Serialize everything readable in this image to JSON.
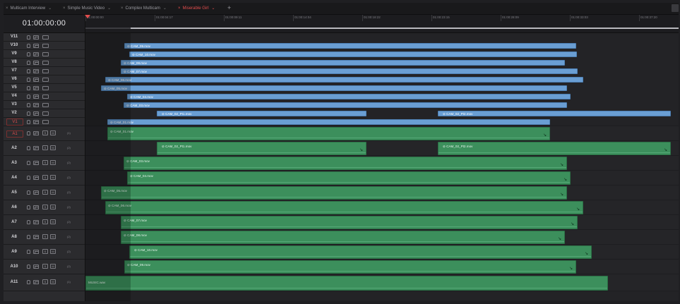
{
  "tabs": [
    {
      "label": "Multicam Interview",
      "active": false
    },
    {
      "label": "Simple Music Video",
      "active": false
    },
    {
      "label": "Complex Multicam",
      "active": false
    },
    {
      "label": "Miserable Girl",
      "active": true
    }
  ],
  "add_tab_label": "+",
  "timecode": "01:00:00:00",
  "ruler_ticks": [
    "01:00:00:00",
    "01:00:04:17",
    "01:00:09:11",
    "01:00:14:04",
    "01:00:18:22",
    "01:00:23:15",
    "01:00:28:09",
    "01:00:33:03",
    "01:00:37:20"
  ],
  "video_tracks": [
    {
      "name": "V11"
    },
    {
      "name": "V10"
    },
    {
      "name": "V9"
    },
    {
      "name": "V8"
    },
    {
      "name": "V7"
    },
    {
      "name": "V6"
    },
    {
      "name": "V5"
    },
    {
      "name": "V4"
    },
    {
      "name": "V3"
    },
    {
      "name": "V2"
    },
    {
      "name": "V1"
    }
  ],
  "audio_tracks": [
    {
      "name": "A1",
      "channels": "(1)",
      "solo": "S",
      "mute": "M"
    },
    {
      "name": "A2",
      "channels": "(2)",
      "solo": "S",
      "mute": "M"
    },
    {
      "name": "A3",
      "channels": "(2)",
      "solo": "S",
      "mute": "M"
    },
    {
      "name": "A4",
      "channels": "(2)",
      "solo": "S",
      "mute": "M"
    },
    {
      "name": "A5",
      "channels": "(2)",
      "solo": "S",
      "mute": "M"
    },
    {
      "name": "A6",
      "channels": "(2)",
      "solo": "S",
      "mute": "M"
    },
    {
      "name": "A7",
      "channels": "(2)",
      "solo": "S",
      "mute": "M"
    },
    {
      "name": "A8",
      "channels": "(2)",
      "solo": "S",
      "mute": "M"
    },
    {
      "name": "A9",
      "channels": "(2)",
      "solo": "S",
      "mute": "M"
    },
    {
      "name": "A10",
      "channels": "(2)",
      "solo": "S",
      "mute": "M"
    },
    {
      "name": "A11",
      "channels": "(1)",
      "solo": "S",
      "mute": "M"
    }
  ],
  "video_clips": [
    {
      "track": "V10",
      "name": "CAM_09.mov"
    },
    {
      "track": "V9",
      "name": "CAM_10.mov"
    },
    {
      "track": "V8",
      "name": "CAM_08.mov"
    },
    {
      "track": "V7",
      "name": "CAM_07.mov"
    },
    {
      "track": "V6",
      "name": "CAM_06.mov"
    },
    {
      "track": "V5",
      "name": "CAM_05.mov"
    },
    {
      "track": "V4",
      "name": "CAM_04.mov"
    },
    {
      "track": "V3",
      "name": "CAM_03.mov"
    },
    {
      "track": "V2",
      "name": "CAM_02_Pt1.mov"
    },
    {
      "track": "V2",
      "name": "CAM_02_Pt2.mov"
    },
    {
      "track": "V1",
      "name": "CAM_01.mov"
    }
  ],
  "audio_clips": [
    {
      "track": "A1",
      "name": "CAM_01.mov"
    },
    {
      "track": "A2",
      "name": "CAM_02_Pt1.mov"
    },
    {
      "track": "A2",
      "name": "CAM_02_Pt2.mov"
    },
    {
      "track": "A3",
      "name": "CAM_03.mov"
    },
    {
      "track": "A4",
      "name": "CAM_04.mov"
    },
    {
      "track": "A5",
      "name": "CAM_05.mov"
    },
    {
      "track": "A6",
      "name": "CAM_06.mov"
    },
    {
      "track": "A7",
      "name": "CAM_07.mov"
    },
    {
      "track": "A8",
      "name": "CAM_08.mov"
    },
    {
      "track": "A9",
      "name": "CAM_10.mov"
    },
    {
      "track": "A10",
      "name": "CAM_09.mov"
    },
    {
      "track": "A11",
      "name": "MUSIC.wav"
    }
  ],
  "colors": {
    "video_clip": "#6a9ed3",
    "audio_clip": "#3c8f5c",
    "playhead": "#e24d4d",
    "active_tab": "#e24d4d"
  },
  "icons": [
    "lock-icon",
    "auto-select-icon",
    "monitor-icon",
    "solo-icon",
    "mute-icon",
    "link-icon",
    "fade-icon",
    "playhead-icon",
    "close-icon",
    "chevron-down-icon"
  ]
}
